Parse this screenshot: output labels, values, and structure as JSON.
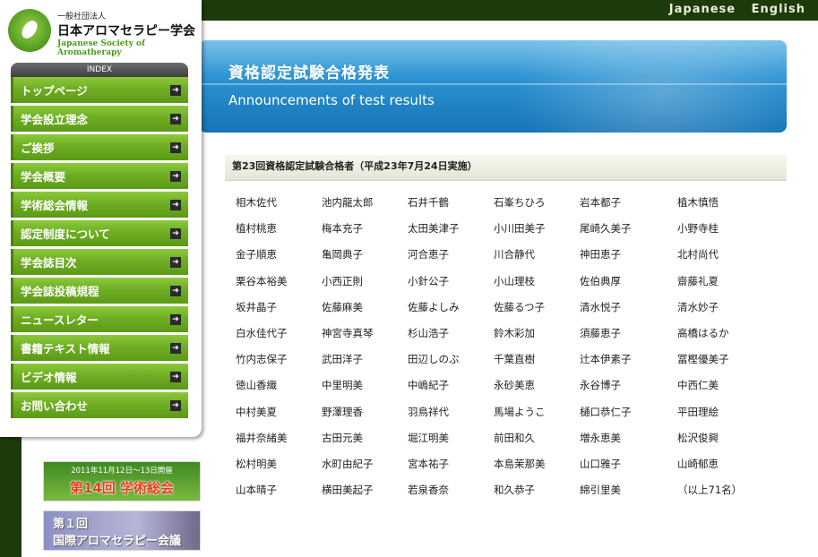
{
  "header": {
    "lang_ja": "Japanese",
    "lang_en": "English"
  },
  "logo": {
    "pre": "一般社団法人",
    "main": "日本アロマセラピー学会",
    "en": "Japanese Society of Aromatherapy"
  },
  "sidebar": {
    "index_label": "INDEX",
    "items": [
      {
        "label": "トップページ"
      },
      {
        "label": "学会設立理念"
      },
      {
        "label": "ご挨拶"
      },
      {
        "label": "学会概要"
      },
      {
        "label": "学術総会情報"
      },
      {
        "label": "認定制度について"
      },
      {
        "label": "学会誌目次"
      },
      {
        "label": "学会誌投稿規程"
      },
      {
        "label": "ニュースレター"
      },
      {
        "label": "書籍テキスト情報"
      },
      {
        "label": "ビデオ情報"
      },
      {
        "label": "お問い合わせ"
      }
    ]
  },
  "banners": {
    "b1_top": "2011年11月12日～13日開催",
    "b1_main": "第14回 学術総会",
    "b2_line1": "第１回",
    "b2_line2": "国際アロマセラピー会議"
  },
  "main": {
    "title_ja": "資格認定試験合格発表",
    "title_en": "Announcements of test results",
    "section_title": "第23回資格認定試験合格者（平成23年7月24日実施）",
    "names": [
      "相木佐代",
      "池内龍太郎",
      "石井千鶴",
      "石峯ちひろ",
      "岩本都子",
      "植木慎悟",
      "植村桃恵",
      "梅本充子",
      "太田美津子",
      "小川田美子",
      "尾崎久美子",
      "小野寺桂",
      "金子順恵",
      "亀岡典子",
      "河合恵子",
      "川合静代",
      "神田恵子",
      "北村尚代",
      "栗谷本裕美",
      "小西正則",
      "小針公子",
      "小山理枝",
      "佐伯典厚",
      "齋藤礼夏",
      "坂井晶子",
      "佐藤麻美",
      "佐藤よしみ",
      "佐藤るつ子",
      "清水悦子",
      "清水妙子",
      "白水佳代子",
      "神宮寺真琴",
      "杉山浩子",
      "鈴木彩加",
      "須藤恵子",
      "高橋はるか",
      "竹内志保子",
      "武田洋子",
      "田辺しのぶ",
      "千葉直樹",
      "辻本伊素子",
      "冨樫優美子",
      "徳山香織",
      "中里明美",
      "中嶋紀子",
      "永砂美恵",
      "永谷博子",
      "中西仁美",
      "中村美夏",
      "野澤理香",
      "羽鳥祥代",
      "馬場ようこ",
      "樋口恭仁子",
      "平田理絵",
      "福井奈緒美",
      "古田元美",
      "堀江明美",
      "前田和久",
      "増永恵美",
      "松沢俊興",
      "松村明美",
      "水町由紀子",
      "宮本祐子",
      "本島茉那美",
      "山口雅子",
      "山崎郁恵",
      "山本晴子",
      "横田美起子",
      "若泉香奈",
      "和久恭子",
      "綿引里美",
      "（以上71名）"
    ]
  }
}
